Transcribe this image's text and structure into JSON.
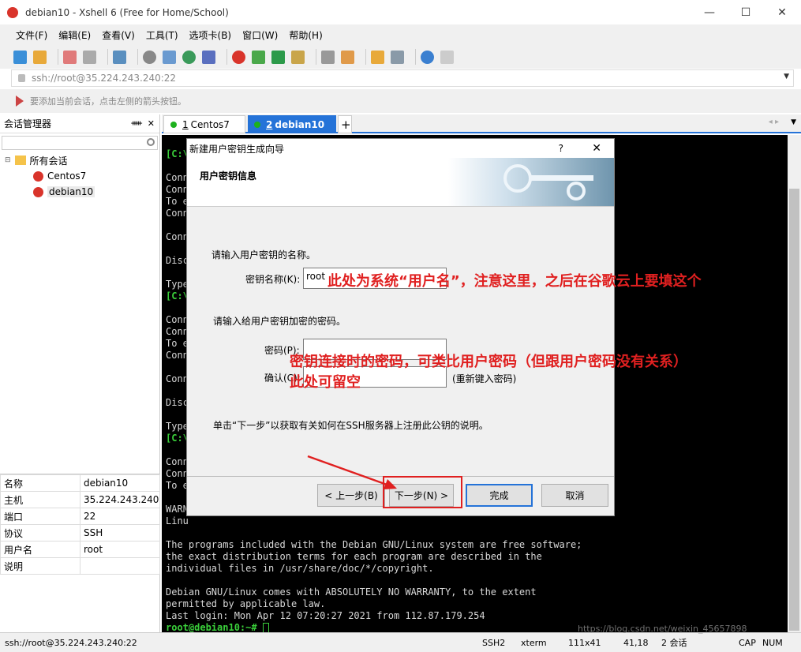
{
  "window": {
    "title": "debian10 - Xshell 6 (Free for Home/School)",
    "minimize": "—",
    "maximize": "☐",
    "close": "✕"
  },
  "menu": [
    "文件(F)",
    "编辑(E)",
    "查看(V)",
    "工具(T)",
    "选项卡(B)",
    "窗口(W)",
    "帮助(H)"
  ],
  "address": {
    "value": "ssh://root@35.224.243.240:22"
  },
  "hint": "要添加当前会话，点击左侧的箭头按钮。",
  "sidebar": {
    "title": "会话管理器",
    "pin": "ᚔ",
    "close": "✕",
    "tree": {
      "root": "所有会话",
      "items": [
        "Centos7",
        "debian10"
      ]
    }
  },
  "props": [
    {
      "k": "名称",
      "v": "debian10"
    },
    {
      "k": "主机",
      "v": "35.224.243.240"
    },
    {
      "k": "端口",
      "v": "22"
    },
    {
      "k": "协议",
      "v": "SSH"
    },
    {
      "k": "用户名",
      "v": "root"
    },
    {
      "k": "说明",
      "v": ""
    }
  ],
  "tabs": [
    {
      "num": "1",
      "label": "Centos7"
    },
    {
      "num": "2",
      "label": "debian10"
    }
  ],
  "tab_add": "+",
  "terminal": {
    "lines": [
      "[C:\\",
      "",
      "Conn",
      "Conn",
      "To e",
      "Conn",
      "",
      "Conn",
      "",
      "Disc",
      "",
      "Type",
      "[C:\\",
      "",
      "Conn",
      "Conn",
      "To e",
      "Conn",
      "",
      "Conn",
      "",
      "Disc",
      "",
      "Type",
      "[C:\\",
      "",
      "Conn",
      "Conn",
      "To e",
      "",
      "WARN",
      "Linu",
      "",
      "The programs included with the Debian GNU/Linux system are free software;",
      "the exact distribution terms for each program are described in the",
      "individual files in /usr/share/doc/*/copyright.",
      "",
      "Debian GNU/Linux comes with ABSOLUTELY NO WARRANTY, to the extent",
      "permitted by applicable law.",
      "Last login: Mon Apr 12 07:20:27 2021 from 112.87.179.254"
    ],
    "prompt": "root@debian10:~# "
  },
  "dialog": {
    "title": "新建用户密钥生成向导",
    "help": "?",
    "close": "✕",
    "banner_title": "用户密钥信息",
    "name_prompt": "请输入用户密钥的名称。",
    "name_label": "密钥名称(K):",
    "name_value": "root",
    "pass_prompt": "请输入给用户密钥加密的密码。",
    "pass_label": "密码(P):",
    "confirm_label": "确认(C):",
    "confirm_hint": "(重新键入密码)",
    "info": "单击“下一步”以获取有关如何在SSH服务器上注册此公钥的说明。",
    "back": "< 上一步(B)",
    "next": "下一步(N) >",
    "finish": "完成",
    "cancel": "取消"
  },
  "annotations": {
    "a1": "此处为系统“用户名”，注意这里，之后在谷歌云上要填这个",
    "a2": "密钥连接时的密码，可类比用户密码（但跟用户密码没有关系）",
    "a3": "此处可留空",
    "color": "#e02020"
  },
  "status": {
    "addr": "ssh://root@35.224.243.240:22",
    "proto": "SSH2",
    "term": "xterm",
    "size": "111x41",
    "pos": "41,18",
    "sessions": "2 会话",
    "cap": "CAP",
    "num": "NUM",
    "watermark": "https://blog.csdn.net/weixin_45657898"
  }
}
